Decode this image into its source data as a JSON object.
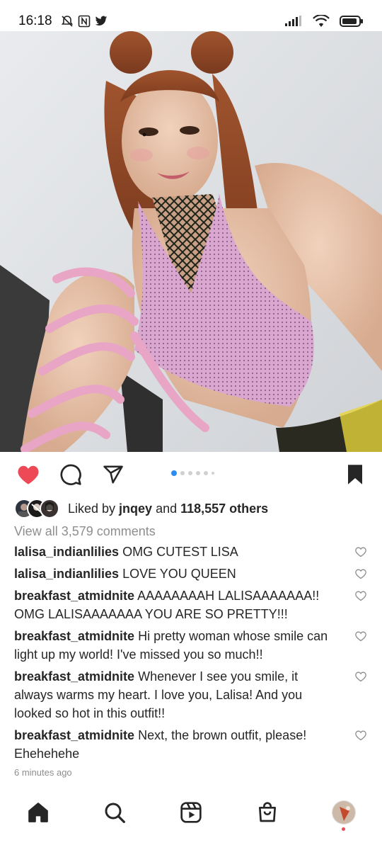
{
  "status_bar": {
    "time": "16:18"
  },
  "post": {
    "carousel_total": 6,
    "carousel_current": 1,
    "liked": true,
    "saved": true
  },
  "likes": {
    "prefix": "Liked by ",
    "user": "jnqey",
    "middle": " and ",
    "others": "118,557 others"
  },
  "view_all_comments": "View all 3,579 comments",
  "comments": [
    {
      "user": "lalisa_indianlilies",
      "text": "OMG CUTEST LISA"
    },
    {
      "user": "lalisa_indianlilies",
      "text": "LOVE YOU QUEEN"
    },
    {
      "user": "breakfast_atmidnite",
      "text": "AAAAAAAAH LALISAAAAAAA!! OMG LALISAAAAAAA YOU ARE SO PRETTY!!!"
    },
    {
      "user": "breakfast_atmidnite",
      "text": "Hi pretty woman whose smile can light up my world! I've missed you so much!!"
    },
    {
      "user": "breakfast_atmidnite",
      "text": "Whenever I see you smile, it always warms my heart. I love you, Lalisa! And you looked so hot in this outfit!!"
    },
    {
      "user": "breakfast_atmidnite",
      "text": "Next, the brown outfit, please! Ehehehehe"
    }
  ],
  "time_ago": "6 minutes ago",
  "colors": {
    "like": "#ed4956",
    "accent": "#2d8cf0",
    "secondary_text": "#8e8e8e"
  },
  "icons": {
    "status": [
      "silent-bell-icon",
      "nfc-icon",
      "twitter-icon",
      "signal-icon",
      "wifi-icon",
      "battery-icon"
    ],
    "actions": [
      "heart-icon",
      "comment-icon",
      "share-icon",
      "bookmark-icon"
    ],
    "nav": [
      "home-icon",
      "search-icon",
      "reels-icon",
      "shop-icon",
      "profile-avatar"
    ]
  }
}
